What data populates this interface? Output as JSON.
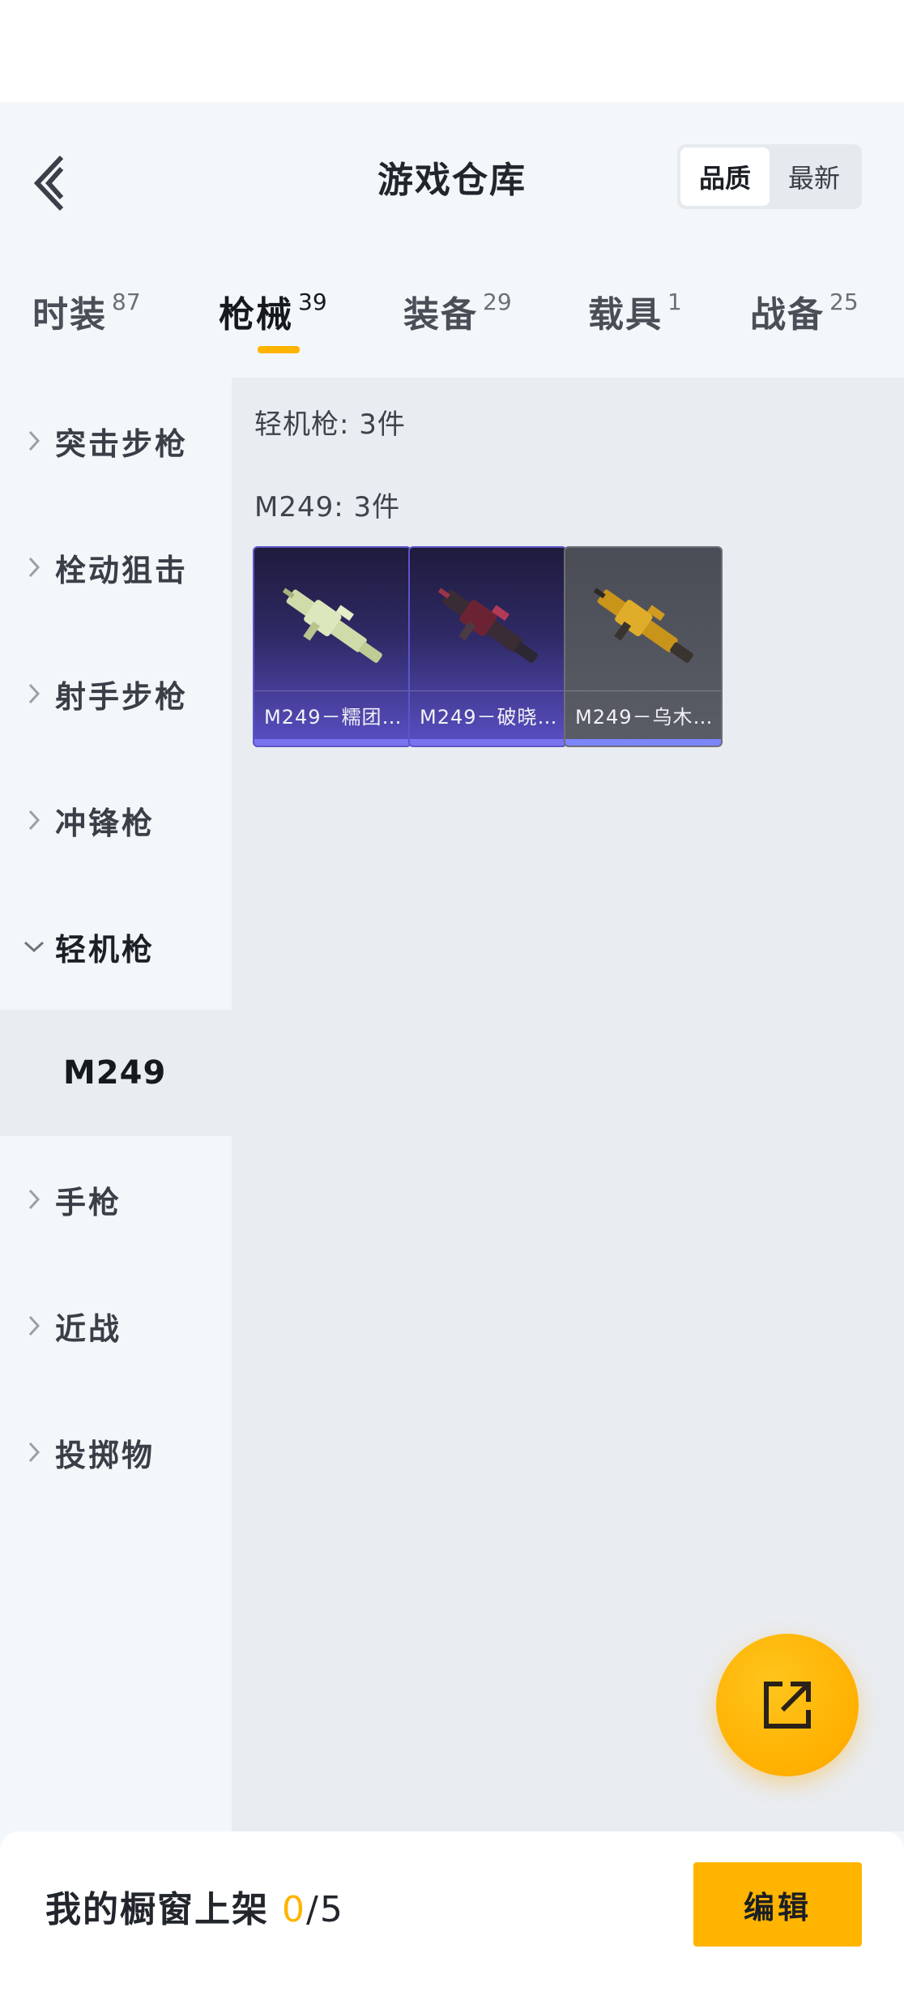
{
  "header": {
    "title": "游戏仓库",
    "sort_options": [
      "品质",
      "最新"
    ],
    "active_sort": "品质"
  },
  "tabs": [
    {
      "label": "时装",
      "count": "87"
    },
    {
      "label": "枪械",
      "count": "39"
    },
    {
      "label": "装备",
      "count": "29"
    },
    {
      "label": "载具",
      "count": "1"
    },
    {
      "label": "战备",
      "count": "25"
    }
  ],
  "active_tab": "枪械",
  "sidebar": {
    "items": [
      {
        "label": "突击步枪"
      },
      {
        "label": "栓动狙击"
      },
      {
        "label": "射手步枪"
      },
      {
        "label": "冲锋枪"
      },
      {
        "label": "轻机枪"
      },
      {
        "label": "手枪"
      },
      {
        "label": "近战"
      },
      {
        "label": "投掷物"
      }
    ],
    "expanded": "轻机枪",
    "sub_item": "M249"
  },
  "content": {
    "category_title": "轻机枪: 3件",
    "group_title": "M249: 3件",
    "cards": [
      {
        "name": "M249－糯团…",
        "rarity": "purple",
        "color": "#c9d8a6"
      },
      {
        "name": "M249－破晓…",
        "rarity": "purple",
        "color": "#8a2c3c"
      },
      {
        "name": "M249－乌木…",
        "rarity": "gray",
        "color": "#d6a21e"
      }
    ]
  },
  "bottom": {
    "showcase_label": "我的橱窗上架",
    "current": "0",
    "total": "/5",
    "edit_label": "编辑"
  },
  "colors": {
    "accent": "#ffb400",
    "purple_card": "#5a4fc4",
    "background": "#f4f7fa"
  },
  "icons": {
    "back": "chevron-left-icon",
    "fab": "share-external-icon"
  }
}
